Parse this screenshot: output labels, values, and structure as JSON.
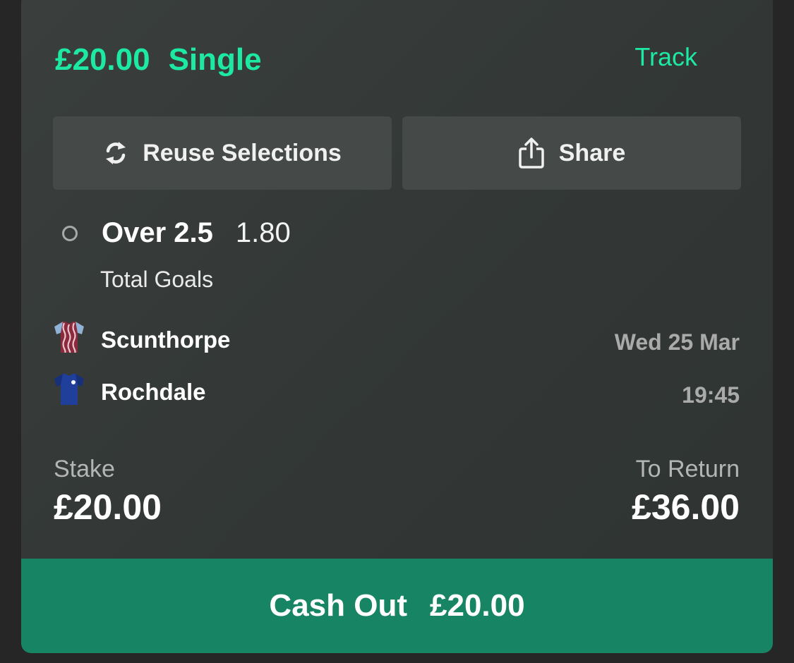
{
  "header": {
    "amount": "£20.00",
    "bet_type": "Single",
    "track_label": "Track"
  },
  "actions": {
    "reuse_label": "Reuse Selections",
    "share_label": "Share"
  },
  "selection": {
    "name": "Over 2.5",
    "odds": "1.80",
    "market": "Total Goals"
  },
  "match": {
    "home_team": "Scunthorpe",
    "away_team": "Rochdale",
    "date": "Wed 25 Mar",
    "time": "19:45"
  },
  "stake": {
    "label": "Stake",
    "value": "£20.00"
  },
  "to_return": {
    "label": "To Return",
    "value": "£36.00"
  },
  "cashout": {
    "label": "Cash Out",
    "amount": "£20.00"
  },
  "colors": {
    "accent": "#1de9a2",
    "cashout_bg": "#178563",
    "card_bg": "#353a38",
    "button_bg": "#454a48"
  },
  "icons": {
    "reuse": "refresh-icon",
    "share": "share-icon",
    "home_shirt": "claret-striped-shirt-icon",
    "away_shirt": "blue-shirt-icon"
  }
}
